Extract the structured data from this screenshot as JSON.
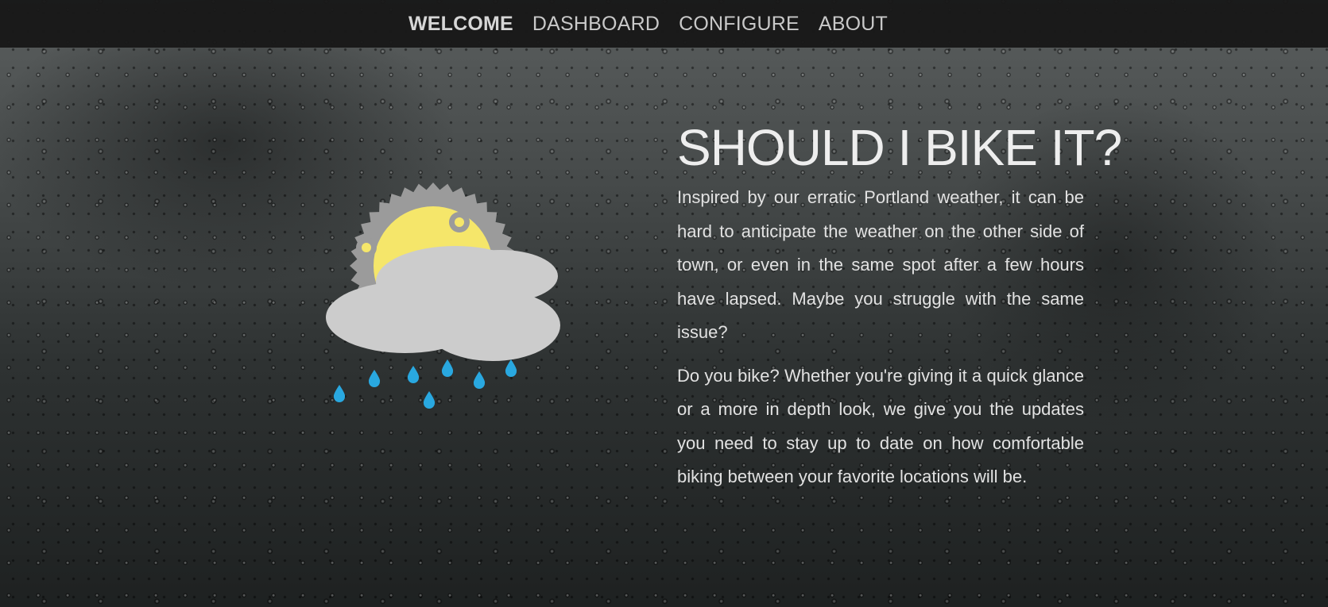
{
  "nav": {
    "items": [
      {
        "label": "WELCOME",
        "active": true
      },
      {
        "label": "DASHBOARD",
        "active": false
      },
      {
        "label": "CONFIGURE",
        "active": false
      },
      {
        "label": "ABOUT",
        "active": false
      }
    ]
  },
  "hero": {
    "title": "SHOULD I BIKE IT?",
    "paragraphs": [
      "Inspired by our erratic Portland weather, it can be hard to anticipate the weather on the other side of town, or even in the same spot after a few hours have lapsed. Maybe you struggle with the same issue?",
      "Do you bike? Whether you're giving it a quick glance or a more in depth look, we give you the updates you need to stay up to date on how comfortable biking between your favorite locations will be."
    ]
  },
  "colors": {
    "sun": "#f5e66a",
    "gear": "#9b9b9b",
    "cloud": "#cccccc",
    "rain": "#29a8e0"
  }
}
